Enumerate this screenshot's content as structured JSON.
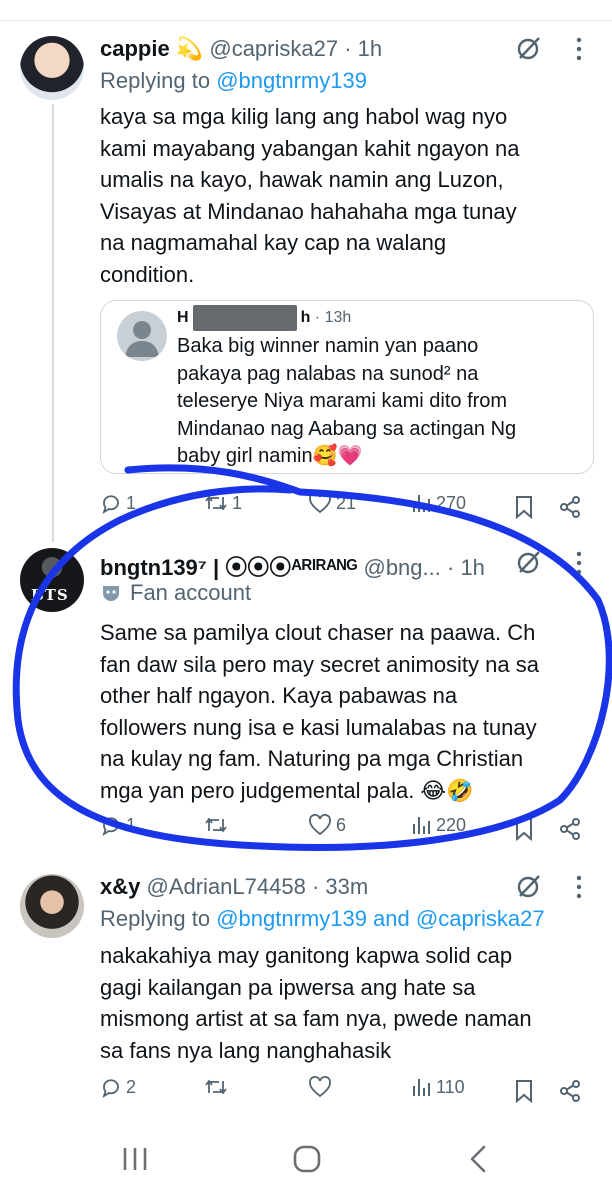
{
  "tweets": [
    {
      "name": "cappie",
      "name_emoji": "💫",
      "handle": "@capriska27",
      "time": "1h",
      "replying_prefix": "Replying to",
      "replying_to": "@bngtnrmy139",
      "text": "kaya sa mga kilig lang ang habol wag nyo kami mayabang yabangan kahit ngayon na umalis na kayo, hawak namin ang Luzon, Visayas at Mindanao hahahaha mga tunay na nagmamahal kay cap na walang condition.",
      "text_lines": [
        "kaya sa mga kilig lang ang habol wag nyo",
        "kami mayabang yabangan kahit ngayon na",
        "umalis na kayo, hawak namin ang Luzon,",
        "Visayas at Mindanao hahahaha mga tunay",
        "na nagmamahal kay cap na walang",
        "condition."
      ],
      "quote": {
        "name_start": "H",
        "name_end": "h",
        "time": "13h",
        "text_lines": [
          "Baka big winner namin yan paano",
          "pakaya pag nalabas na sunod² na",
          "teleserye Niya marami kami dito from",
          "Mindanao nag Aabang sa actingan Ng",
          "baby girl namin🥰💗"
        ]
      },
      "replies": "1",
      "reposts": "1",
      "likes": "21",
      "views": "270"
    },
    {
      "name": "bngtn139⁷ | ⦿⦿⦿ᴬᴿᴵᴿᴬᴺᴳ",
      "handle": "@bng...",
      "time": "1h",
      "badge": "Fan account",
      "text_lines": [
        "Same sa pamilya clout chaser na paawa. Ch",
        "fan daw sila pero may secret animosity na sa",
        "other half ngayon. Kaya pabawas na",
        "followers nung isa e kasi lumalabas na tunay",
        "na kulay ng fam. Naturing pa mga Christian",
        "mga yan pero judgemental pala. 😂🤣"
      ],
      "replies": "1",
      "reposts": "",
      "likes": "6",
      "views": "220"
    },
    {
      "name": "x&y",
      "handle": "@AdrianL74458",
      "time": "33m",
      "replying_prefix": "Replying to",
      "replying_to": "@bngtnrmy139 and @capriska27",
      "text_lines": [
        "nakakahiya may ganitong kapwa solid cap",
        "gagi kailangan pa ipwersa ang hate sa",
        "mismong artist at sa fam nya, pwede naman",
        "sa fans nya lang nanghahasik"
      ],
      "replies": "2",
      "reposts": "",
      "likes": "",
      "views": "110"
    }
  ],
  "avatar2_text": "BTS",
  "colors": {
    "accent": "#1d9bf0",
    "secondary_text": "#536471",
    "annotation": "#1a35e8"
  },
  "icons": [
    "grok-icon",
    "more-icon",
    "reply-icon",
    "repost-icon",
    "like-icon",
    "views-icon",
    "bookmark-icon",
    "share-icon",
    "nav-recents-icon",
    "nav-home-icon",
    "nav-back-icon"
  ]
}
